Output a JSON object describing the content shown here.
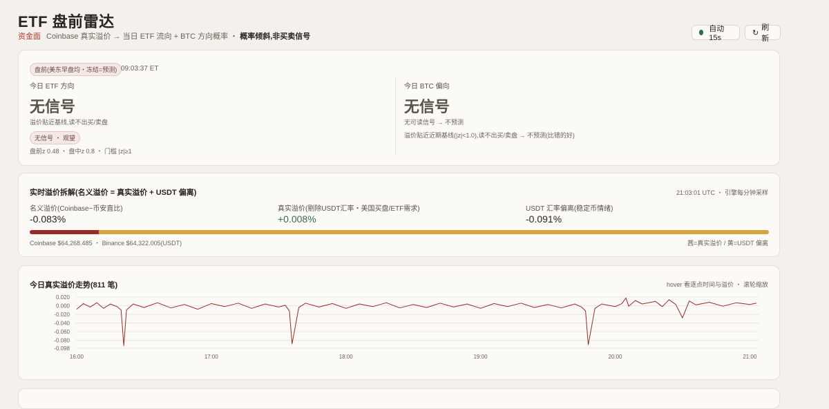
{
  "page": {
    "title": "ETF 盘前雷达",
    "subtitle_tag": "资金面",
    "subtitle_text": "Coinbase 真实溢价 → 当日 ETF 流向 + BTC 方向概率 ・",
    "subtitle_strong": "概率倾斜,非买卖信号"
  },
  "controls": {
    "auto_label": "自动 15s",
    "refresh_label": "刷新",
    "refresh_icon": "↻"
  },
  "signal": {
    "status_pill": "盘前(美东早盘均・冻结=预测)",
    "time": "09:03:37 ET",
    "etf": {
      "label": "今日 ETF 方向",
      "value": "无信号",
      "desc": "溢价贴近基线,读不出买/卖盘",
      "tag": "无信号 ・ 观望",
      "z": "盘前z 0.48 ・ 盘中z 0.8 ・ 门槛 |z|≥1"
    },
    "btc": {
      "label": "今日 BTC 偏向",
      "value": "无信号",
      "desc": "无可读信号 → 不预测",
      "detail": "溢价贴近近期基线(|z|<1.0),读不出买/卖盘 → 不预测(比错的好)"
    }
  },
  "premium": {
    "title": "实时溢价拆解(名义溢价 = 真实溢价 + USDT 偏离)",
    "meta": "21:03:01 UTC ・ 引擎每分钟采样",
    "nominal_label": "名义溢价(Coinbase−币安直比)",
    "nominal_value": "-0.083%",
    "real_label": "真实溢价(剔除USDT汇率・美国买盘/ETF需求)",
    "real_value": "+0.008%",
    "usdt_label": "USDT 汇率偏离(稳定币情绪)",
    "usdt_value": "-0.091%",
    "bar_red_fraction": 0.093,
    "prices": "Coinbase $64,268.485 ・ Binance $64,322.005(USDT)",
    "legend": "茜=真实溢价 / 黄=USDT 偏离",
    "colors": {
      "red": "#9a2a2a",
      "yellow": "#d9a33b"
    }
  },
  "trend": {
    "title": "今日真实溢价走势(811 笔)",
    "hint": "hover 看逐点时间与溢价 ・ 滚轮缩放"
  },
  "chart_data": {
    "type": "line",
    "xlabel": "",
    "ylabel": "",
    "x_ticks": [
      "16:00",
      "17:00",
      "18:00",
      "19:00",
      "20:00",
      "21:00"
    ],
    "y_ticks": [
      "0.020",
      "0.000",
      "-0.020",
      "-0.040",
      "-0.060",
      "-0.080",
      "-0.098"
    ],
    "ylim": [
      -0.098,
      0.028
    ],
    "xlim": [
      15.99,
      21.07
    ],
    "grid": true,
    "series": [
      {
        "color": "#9a2a2a",
        "x": [
          16.0,
          16.05,
          16.1,
          16.15,
          16.2,
          16.25,
          16.3,
          16.33,
          16.35,
          16.37,
          16.42,
          16.5,
          16.6,
          16.7,
          16.8,
          16.9,
          17.0,
          17.1,
          17.2,
          17.3,
          17.4,
          17.5,
          17.55,
          17.58,
          17.6,
          17.65,
          17.7,
          17.8,
          17.9,
          18.0,
          18.1,
          18.2,
          18.3,
          18.4,
          18.5,
          18.6,
          18.7,
          18.8,
          18.9,
          19.0,
          19.1,
          19.2,
          19.3,
          19.4,
          19.5,
          19.6,
          19.7,
          19.75,
          19.78,
          19.8,
          19.85,
          19.9,
          20.0,
          20.05,
          20.08,
          20.1,
          20.15,
          20.2,
          20.3,
          20.35,
          20.4,
          20.45,
          20.5,
          20.55,
          20.6,
          20.7,
          20.8,
          20.9,
          21.0,
          21.05
        ],
        "values": [
          -0.008,
          0.005,
          -0.003,
          0.007,
          -0.006,
          0.004,
          -0.002,
          -0.01,
          -0.092,
          -0.01,
          0.004,
          -0.004,
          0.007,
          -0.005,
          0.003,
          -0.008,
          0.005,
          -0.002,
          0.006,
          -0.006,
          0.004,
          -0.003,
          0.001,
          -0.012,
          -0.088,
          -0.004,
          0.006,
          -0.003,
          0.005,
          -0.006,
          0.004,
          -0.002,
          0.007,
          -0.005,
          0.003,
          -0.004,
          0.006,
          -0.003,
          0.004,
          -0.006,
          0.005,
          -0.002,
          0.006,
          -0.004,
          0.003,
          -0.005,
          0.004,
          -0.003,
          -0.012,
          -0.09,
          -0.006,
          0.004,
          -0.002,
          0.005,
          0.018,
          -0.001,
          0.012,
          0.004,
          0.01,
          -0.002,
          0.014,
          0.003,
          -0.028,
          0.011,
          0.002,
          0.008,
          -0.001,
          0.007,
          0.003,
          0.006
        ]
      }
    ]
  }
}
